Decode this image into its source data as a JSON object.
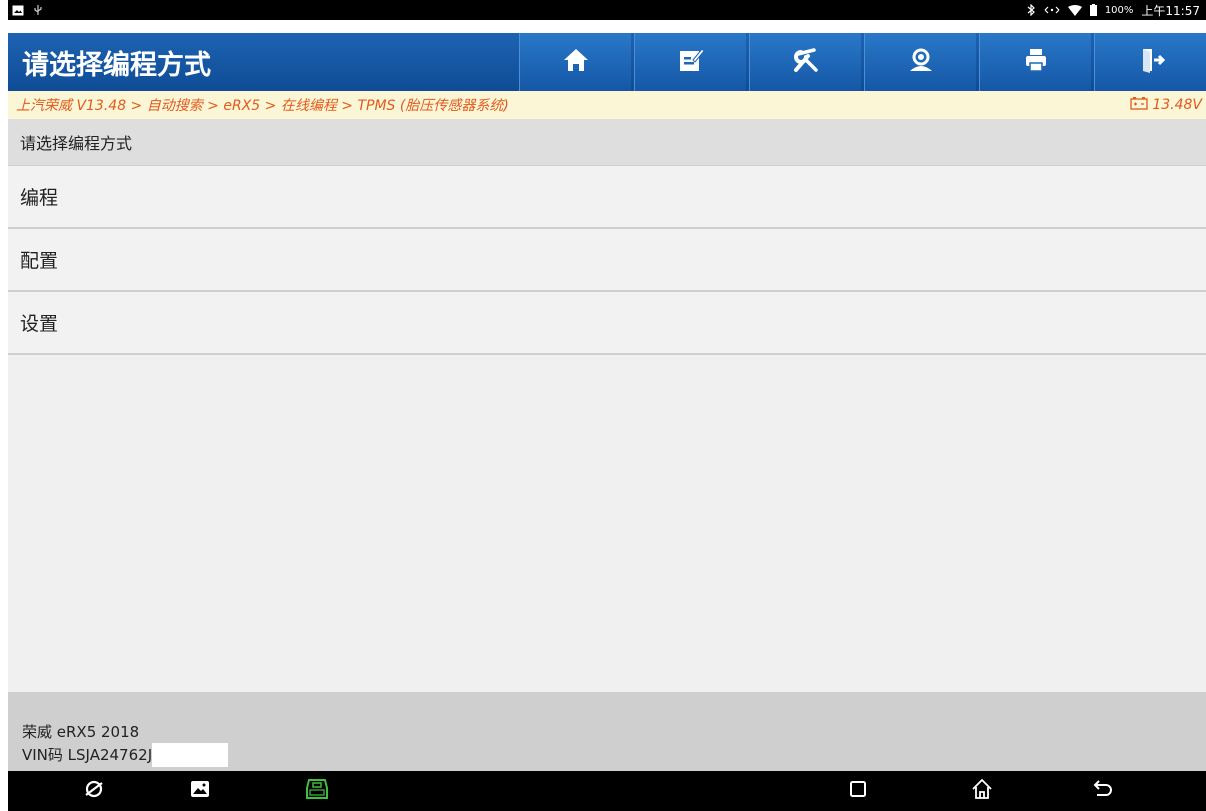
{
  "statusbar": {
    "battery": "100%",
    "time": "上午11:57"
  },
  "titlebar": {
    "title": "请选择编程方式",
    "buttons": [
      {
        "icon": "home-icon"
      },
      {
        "icon": "edit-report-icon"
      },
      {
        "icon": "tools-icon"
      },
      {
        "icon": "support-icon"
      },
      {
        "icon": "print-icon"
      },
      {
        "icon": "exit-icon"
      }
    ]
  },
  "breadcrumb": {
    "path": "上汽荣威 V13.48 > 自动搜索 > eRX5 > 在线编程 > TPMS (胎压传感器系统)",
    "voltage": "13.48V"
  },
  "main": {
    "header": "请选择编程方式",
    "items": [
      {
        "label": "编程"
      },
      {
        "label": "配置"
      },
      {
        "label": "设置"
      }
    ]
  },
  "footer": {
    "vehicle": "荣威 eRX5 2018",
    "vin": "VIN码 LSJA24762J"
  },
  "colors": {
    "title_bar": "#0f4c95",
    "breadcrumb_text": "#e25a1c",
    "breadcrumb_bg": "#fbf6d6",
    "vci_icon": "#3fbf3f"
  }
}
